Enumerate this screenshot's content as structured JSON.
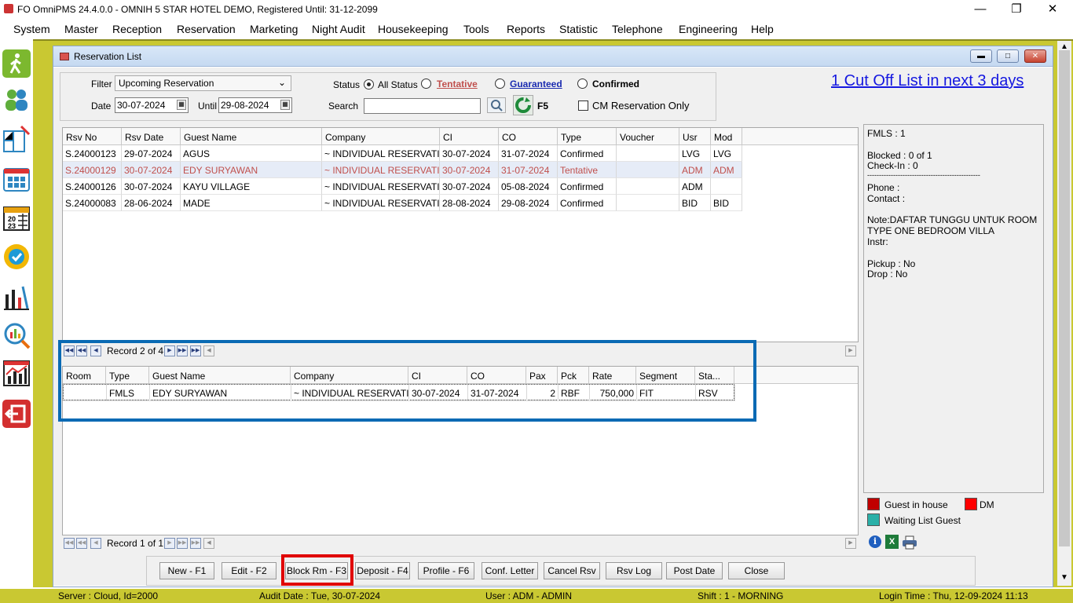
{
  "window": {
    "title": "FO OmniPMS 24.4.0.0 - OMNIH 5 STAR HOTEL DEMO, Registered Until: 31-12-2099"
  },
  "menu": [
    "System",
    "Master",
    "Reception",
    "Reservation",
    "Marketing",
    "Night Audit",
    "Housekeeping",
    "Tools",
    "Reports",
    "Statistic",
    "Telephone",
    "Engineering",
    "Help"
  ],
  "child": {
    "title": "Reservation List"
  },
  "filter": {
    "filter_label": "Filter",
    "filter_value": "Upcoming Reservation",
    "date_label": "Date",
    "date_value": "30-07-2024",
    "until_label": "Until",
    "until_value": "29-08-2024",
    "status_label": "Status",
    "status_options": [
      "All Status",
      "Tentative",
      "Guaranteed",
      "Confirmed"
    ],
    "status_selected": "All Status",
    "search_label": "Search",
    "search_value": "",
    "refresh_key": "F5",
    "cm_only_label": "CM Reservation Only"
  },
  "cutoff_link": "1 Cut Off List in next 3 days",
  "reservations": {
    "columns": [
      "Rsv No",
      "Rsv Date",
      "Guest Name",
      "Company",
      "CI",
      "CO",
      "Type",
      "Voucher",
      "Usr",
      "Mod"
    ],
    "rows": [
      [
        "S.24000123",
        "29-07-2024",
        "AGUS",
        "~ INDIVIDUAL RESERVATI...",
        "30-07-2024",
        "31-07-2024",
        "Confirmed",
        "",
        "LVG",
        "LVG"
      ],
      [
        "S.24000129",
        "30-07-2024",
        "EDY SURYAWAN",
        "~ INDIVIDUAL RESERVATI...",
        "30-07-2024",
        "31-07-2024",
        "Tentative",
        "",
        "ADM",
        "ADM"
      ],
      [
        "S.24000126",
        "30-07-2024",
        "KAYU VILLAGE",
        "~ INDIVIDUAL RESERVATI...",
        "30-07-2024",
        "05-08-2024",
        "Confirmed",
        "",
        "ADM",
        ""
      ],
      [
        "S.24000083",
        "28-06-2024",
        "MADE",
        "~ INDIVIDUAL RESERVATI...",
        "28-08-2024",
        "29-08-2024",
        "Confirmed",
        "",
        "BID",
        "BID"
      ]
    ],
    "selected_index": 1,
    "record_text": "Record 2 of 4"
  },
  "rooms": {
    "columns": [
      "Room",
      "Type",
      "Guest Name",
      "Company",
      "CI",
      "CO",
      "Pax",
      "Pck",
      "Rate",
      "Segment",
      "Sta..."
    ],
    "rows": [
      [
        "",
        "FMLS",
        "EDY SURYAWAN",
        "~ INDIVIDUAL RESERVATI...",
        "30-07-2024",
        "31-07-2024",
        "2",
        "RBF",
        "750,000",
        "FIT",
        "RSV"
      ]
    ],
    "record_text": "Record 1 of 1"
  },
  "info_panel": {
    "lines": [
      "FMLS : 1",
      "",
      "Blocked : 0 of 1",
      "Check-In : 0",
      "------------------------------------------------",
      "Phone :",
      "Contact :",
      "",
      "Note:DAFTAR TUNGGU UNTUK ROOM",
      "TYPE ONE BEDROOM VILLA",
      "Instr:",
      "",
      "Pickup : No",
      "Drop : No"
    ],
    "legend": [
      {
        "label": "Guest in house",
        "color": "#c00000"
      },
      {
        "label": "DM",
        "color": "#ff0000"
      },
      {
        "label": "Waiting List Guest",
        "color": "#2ab0a8"
      }
    ]
  },
  "buttons": [
    "New - F1",
    "Edit - F2",
    "Block Rm - F3",
    "Deposit - F4",
    "Profile - F6",
    "Conf. Letter",
    "Cancel Rsv",
    "Rsv Log",
    "Post Date",
    "Close"
  ],
  "highlight_button": "Block Rm - F3",
  "status": {
    "server": "Server : Cloud, Id=2000",
    "audit": "Audit Date : Tue, 30-07-2024",
    "user": "User : ADM - ADMIN",
    "shift": "Shift : 1 - MORNING",
    "login": "Login Time : Thu, 12-09-2024 11:13"
  },
  "colors": {
    "olive": "#c9c832",
    "tentative": "#c0504d",
    "link": "#1518e0",
    "highlight_blue": "#0a6ab4",
    "highlight_red": "#e00000"
  }
}
